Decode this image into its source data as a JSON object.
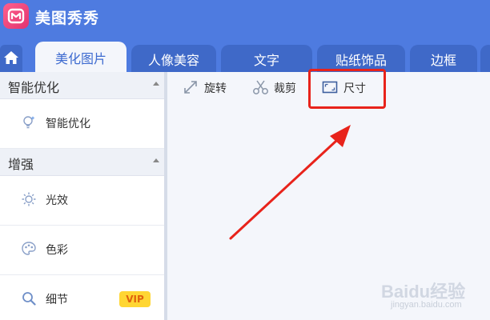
{
  "app": {
    "title": "美图秀秀",
    "logo_icon": "meitu-logo-icon"
  },
  "tabs": [
    {
      "label": "美化图片",
      "active": true
    },
    {
      "label": "人像美容",
      "active": false
    },
    {
      "label": "文字",
      "active": false
    },
    {
      "label": "贴纸饰品",
      "active": false
    },
    {
      "label": "边框",
      "active": false
    }
  ],
  "home_icon": "home-icon",
  "sidebar": {
    "sections": [
      {
        "header": "智能优化",
        "items": [
          {
            "label": "智能优化",
            "icon": "bulb-sparkle-icon"
          }
        ]
      },
      {
        "header": "增强",
        "items": [
          {
            "label": "光效",
            "icon": "sun-icon"
          },
          {
            "label": "色彩",
            "icon": "palette-icon"
          },
          {
            "label": "细节",
            "icon": "magnifier-icon",
            "badge": "VIP"
          }
        ]
      }
    ]
  },
  "toolbar": {
    "rotate_label": "旋转",
    "crop_label": "裁剪",
    "resize_label": "尺寸"
  },
  "annotation": {
    "highlight_color": "#e8231b"
  },
  "watermark": {
    "text": "Baidu经验",
    "url": "jingyan.baidu.com"
  },
  "colors": {
    "brand_blue": "#4e7be0",
    "active_tab_text": "#3e6bd0",
    "vip_badge": "#ffd633"
  }
}
